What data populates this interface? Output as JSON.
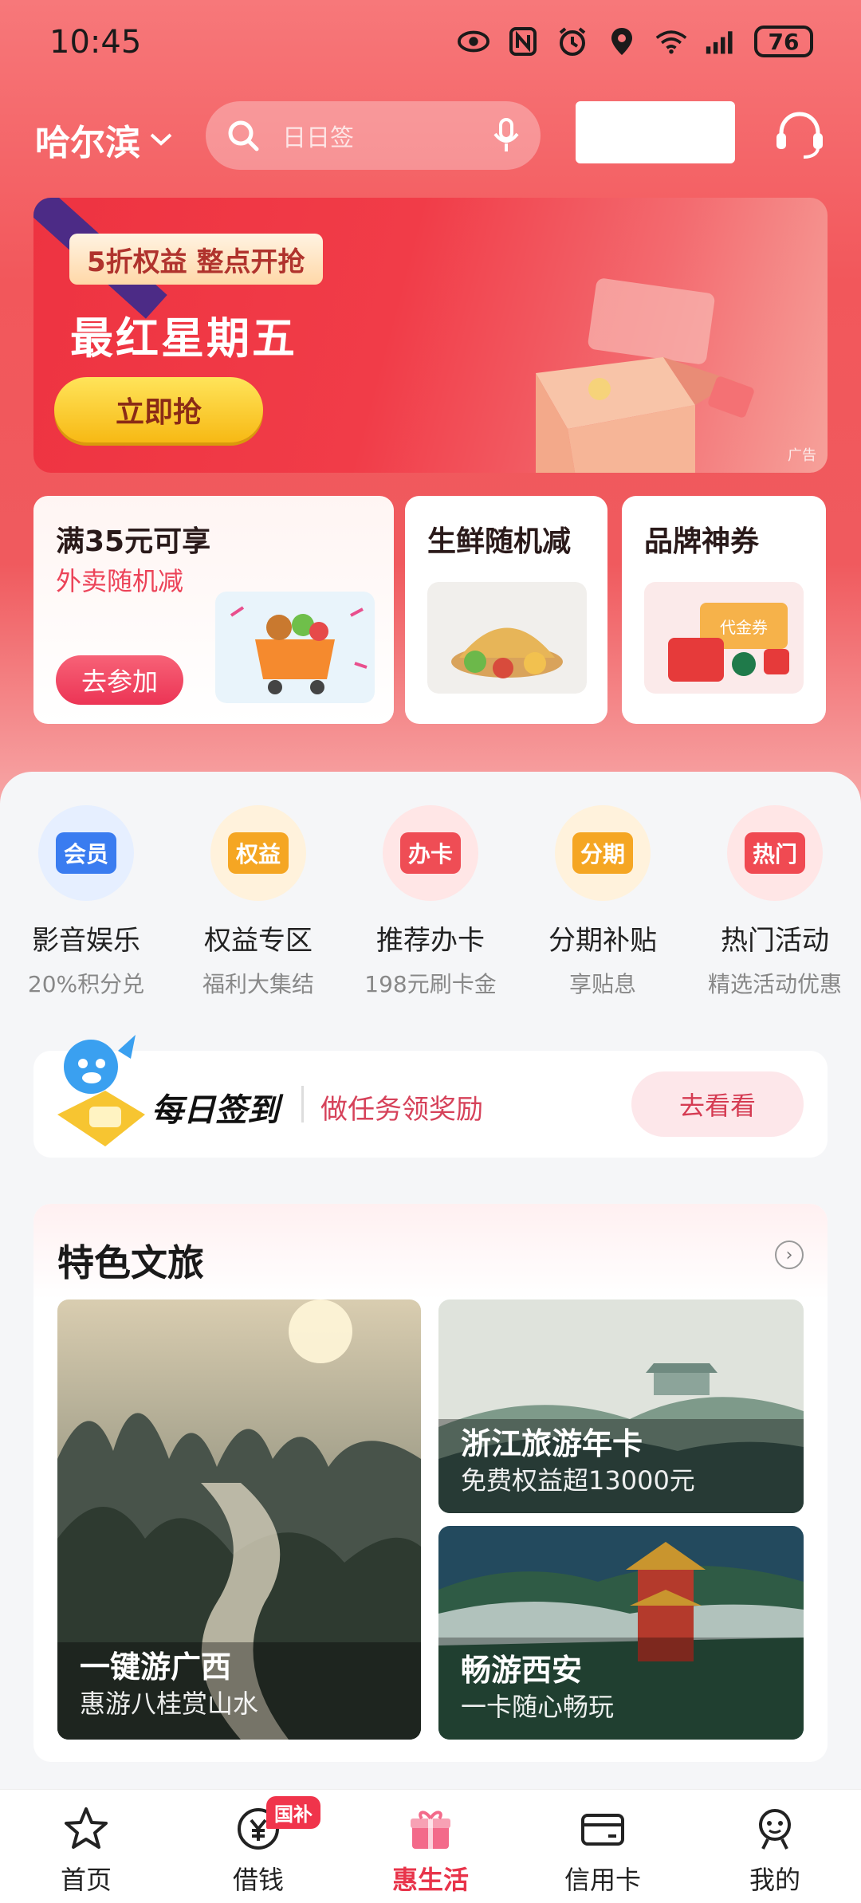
{
  "status_bar": {
    "time": "10:45",
    "battery": "76"
  },
  "header": {
    "city": "哈尔滨",
    "search_placeholder": "日日签"
  },
  "banner": {
    "tag": "5折权益 整点开抢",
    "title": "最红星期五",
    "button": "立即抢",
    "ad_label": "广告"
  },
  "promo_cards": [
    {
      "title": "满35元可享",
      "subtitle": "外卖随机减",
      "button": "去参加"
    },
    {
      "title": "生鲜随机减"
    },
    {
      "title": "品牌神券",
      "coupon_text": "代金券"
    }
  ],
  "quick_entries": [
    {
      "badge": "会员",
      "title": "影音娱乐",
      "subtitle": "20%积分兑",
      "color": "#3a7cf0"
    },
    {
      "badge": "权益",
      "title": "权益专区",
      "subtitle": "福利大集结",
      "color": "#f5a623"
    },
    {
      "badge": "办卡",
      "title": "推荐办卡",
      "subtitle": "198元刷卡金",
      "color": "#ef4d55"
    },
    {
      "badge": "分期",
      "title": "分期补贴",
      "subtitle": "享贴息",
      "color": "#f5a623"
    },
    {
      "badge": "热门",
      "title": "热门活动",
      "subtitle": "精选活动优惠",
      "color": "#f04a52"
    }
  ],
  "checkin": {
    "title": "每日签到",
    "subtitle": "做任务领奖励",
    "button": "去看看"
  },
  "travel": {
    "title": "特色文旅",
    "cards": [
      {
        "title": "一键游广西",
        "subtitle": "惠游八桂赏山水"
      },
      {
        "title": "浙江旅游年卡",
        "subtitle": "免费权益超13000元"
      },
      {
        "title": "畅游西安",
        "subtitle": "一卡随心畅玩"
      }
    ]
  },
  "bottom_nav": {
    "items": [
      {
        "label": "首页",
        "icon": "star-icon"
      },
      {
        "label": "借钱",
        "icon": "yuan-icon",
        "badge": "国补"
      },
      {
        "label": "惠生活",
        "icon": "gift-icon",
        "active": true
      },
      {
        "label": "信用卡",
        "icon": "card-icon"
      },
      {
        "label": "我的",
        "icon": "profile-icon"
      }
    ]
  },
  "colors": {
    "brand_red": "#e8344a",
    "accent_yellow": "#f7b914"
  }
}
